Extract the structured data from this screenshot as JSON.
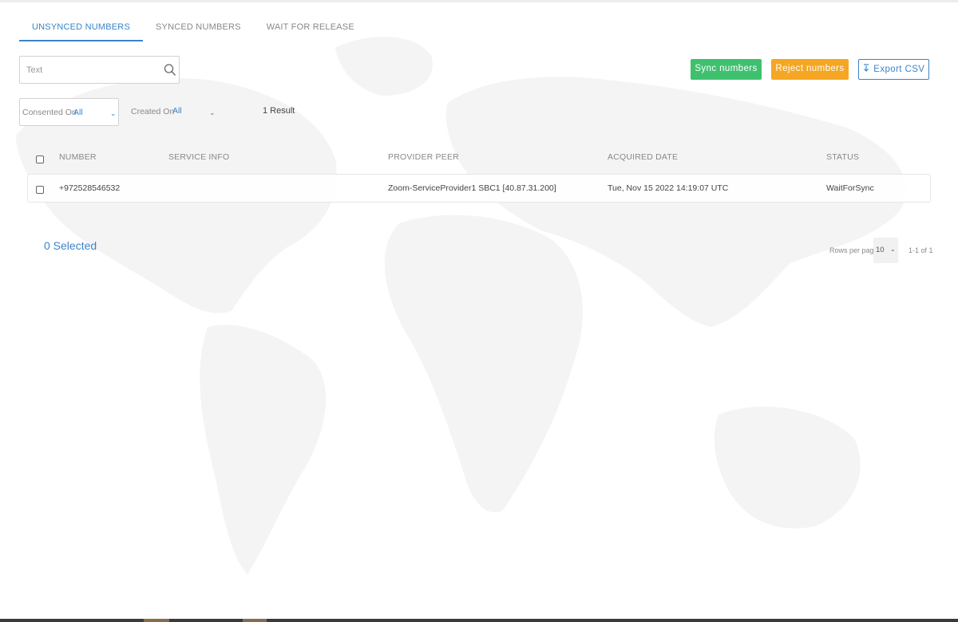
{
  "tabs": [
    {
      "label": "UNSYNCED NUMBERS",
      "active": true
    },
    {
      "label": "SYNCED NUMBERS",
      "active": false
    },
    {
      "label": "WAIT FOR RELEASE",
      "active": false
    }
  ],
  "search": {
    "placeholder": "Text",
    "value": ""
  },
  "actions": {
    "sync_label": "Sync numbers",
    "reject_label": "Reject numbers",
    "export_label": "Export CSV"
  },
  "filters": {
    "consented_label": "Consented On",
    "consented_value": "All",
    "created_label": "Created On",
    "created_value": "All"
  },
  "result_count": "1 Result",
  "table": {
    "columns": [
      "NUMBER",
      "SERVICE INFO",
      "PROVIDER PEER",
      "ACQUIRED DATE",
      "STATUS"
    ],
    "rows": [
      {
        "number": "+972528546532",
        "service_info": "",
        "provider_peer": "Zoom-ServiceProvider1 SBC1 [40.87.31.200]",
        "acquired_date": "Tue, Nov 15 2022 14:19:07 UTC",
        "status": "WaitForSync"
      }
    ]
  },
  "footer": {
    "selected": "0 Selected",
    "rows_per_page_label": "Rows per page:",
    "rows_per_page_value": "10",
    "range": "1-1 of 1"
  },
  "colors": {
    "accent": "#3a84c9",
    "sync": "#3fc06f",
    "reject": "#f5a623"
  },
  "icons": {
    "search": "search-icon",
    "export": "download-icon",
    "dropdown": "chevron-down-icon",
    "background": "world-map-icon"
  }
}
